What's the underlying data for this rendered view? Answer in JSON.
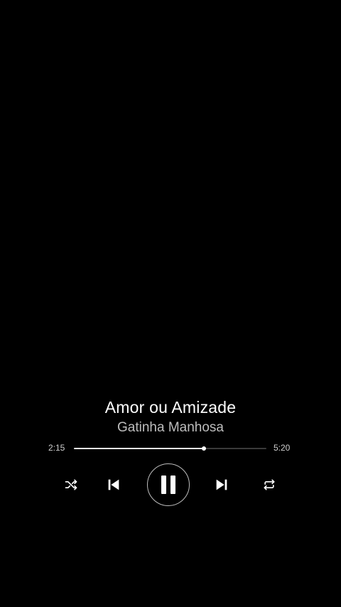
{
  "song": {
    "title": "Amor ou Amizade",
    "artist": "Gatinha Manhosa"
  },
  "progress": {
    "elapsed": "2:15",
    "duration": "5:20",
    "fraction": 0.675
  },
  "controls": {
    "shuffle_icon": "shuffle-icon",
    "prev_icon": "skip-previous-icon",
    "play_state_icon": "pause-icon",
    "next_icon": "skip-next-icon",
    "repeat_icon": "repeat-icon"
  },
  "colors": {
    "background": "#000000",
    "primary_text": "#ffffff",
    "secondary_text": "#bdbdbd",
    "progress_fill": "#e6e6e6",
    "progress_track": "#3a3a3a"
  }
}
